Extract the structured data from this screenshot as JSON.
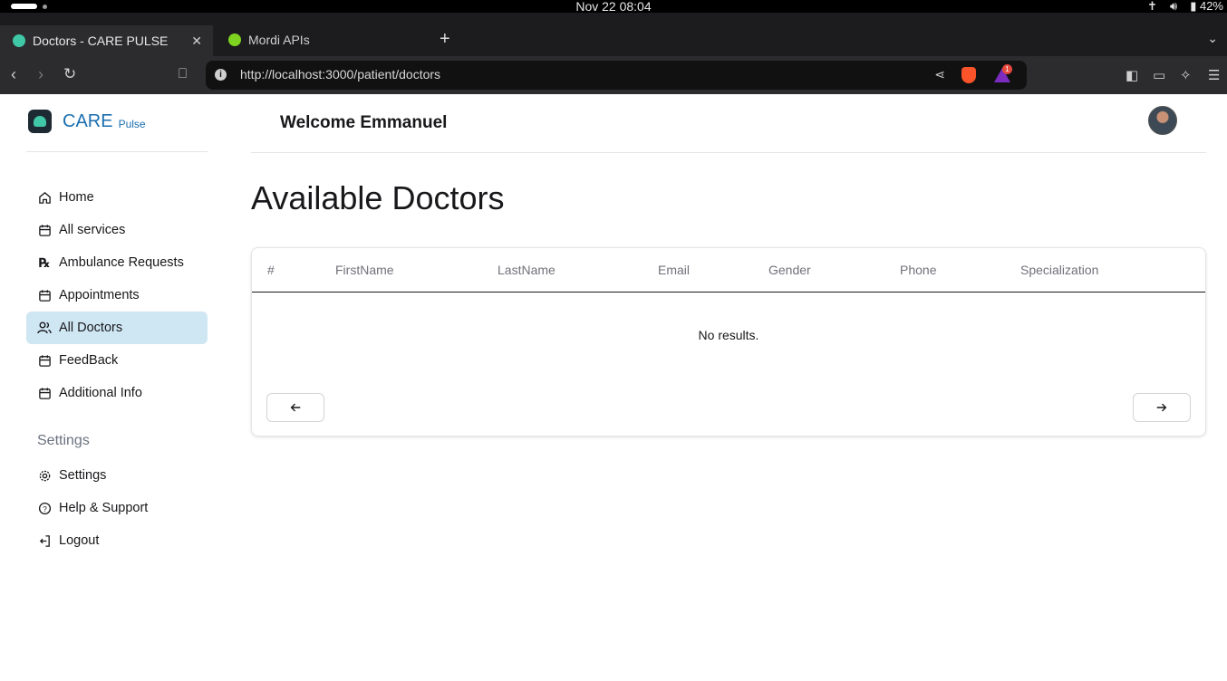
{
  "os": {
    "clock": "Nov 22  08:04",
    "battery": "42%"
  },
  "browser": {
    "tabs": [
      {
        "title": "Doctors - CARE PULSE",
        "favicon_color": "#3fc7a6"
      },
      {
        "title": "Mordi APIs",
        "favicon_color": "#7ed321"
      }
    ],
    "new_tab": "+",
    "url": "http://localhost:3000/patient/doctors",
    "rewards_badge": "1"
  },
  "brand": {
    "name": "CARE",
    "sub": "Pulse",
    "color": "#1b6fb0"
  },
  "sidebar": {
    "items": [
      {
        "label": "Home",
        "icon": "home-icon"
      },
      {
        "label": "All services",
        "icon": "calendar-icon"
      },
      {
        "label": "Ambulance Requests",
        "icon": "prescription-icon"
      },
      {
        "label": "Appointments",
        "icon": "calendar-icon"
      },
      {
        "label": "All Doctors",
        "icon": "users-icon",
        "active": true
      },
      {
        "label": "FeedBack",
        "icon": "calendar-icon"
      },
      {
        "label": "Additional Info",
        "icon": "calendar-icon"
      }
    ],
    "settings_heading": "Settings",
    "settings_items": [
      {
        "label": "Settings",
        "icon": "gear-icon"
      },
      {
        "label": "Help & Support",
        "icon": "help-icon"
      },
      {
        "label": "Logout",
        "icon": "logout-icon"
      }
    ],
    "active_color": "#cfe6f3"
  },
  "header": {
    "welcome": "Welcome Emmanuel"
  },
  "main": {
    "title": "Available Doctors",
    "table": {
      "columns": [
        "#",
        "FirstName",
        "LastName",
        "Email",
        "Gender",
        "Phone",
        "Specialization"
      ],
      "empty_text": "No results."
    },
    "pagination": {
      "prev": "←",
      "next": "→"
    }
  }
}
